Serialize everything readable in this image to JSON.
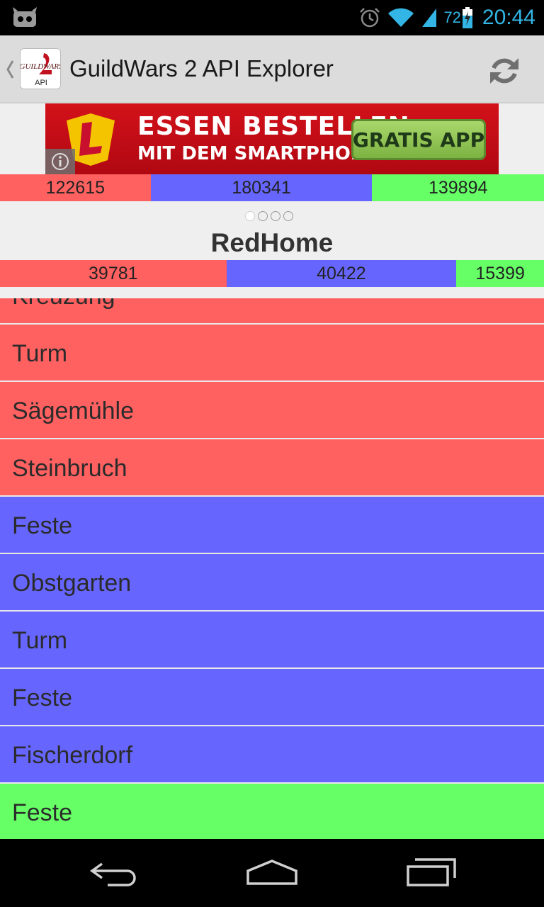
{
  "status_bar": {
    "battery_level": "72",
    "time": "20:44",
    "accent_color": "#33b5e5"
  },
  "action_bar": {
    "title": "GuildWars 2 API Explorer",
    "app_icon_logo_text": "GUILDWARS",
    "app_icon_sub_label": "API"
  },
  "ad": {
    "line1": "ESSEN BESTELLEN",
    "line2": "MIT DEM SMARTPHONE!",
    "cta_label": "GRATIS APP"
  },
  "colors": {
    "red": "#ff6161",
    "blue": "#6666ff",
    "green": "#66ff66"
  },
  "total_scores": {
    "red": "122615",
    "blue": "180341",
    "green": "139894"
  },
  "pager": {
    "page_count": 4,
    "active_page": 1,
    "map_name": "RedHome"
  },
  "map_scores": {
    "red": "39781",
    "blue": "40422",
    "green": "15399"
  },
  "objectives": [
    {
      "name": "Kreuzung",
      "owner": "red"
    },
    {
      "name": "Turm",
      "owner": "red"
    },
    {
      "name": "Sägemühle",
      "owner": "red"
    },
    {
      "name": "Steinbruch",
      "owner": "red"
    },
    {
      "name": "Feste",
      "owner": "blue"
    },
    {
      "name": "Obstgarten",
      "owner": "blue"
    },
    {
      "name": "Turm",
      "owner": "blue"
    },
    {
      "name": "Feste",
      "owner": "blue"
    },
    {
      "name": "Fischerdorf",
      "owner": "blue"
    },
    {
      "name": "Feste",
      "owner": "green"
    }
  ]
}
